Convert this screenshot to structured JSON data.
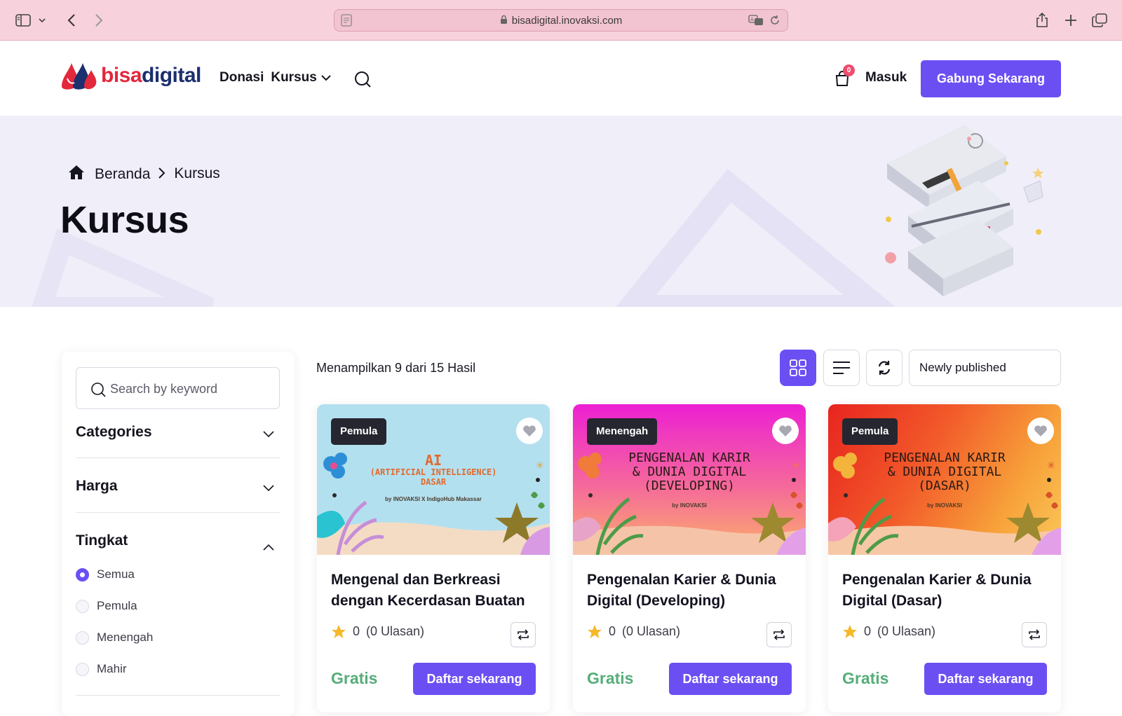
{
  "browser": {
    "url": "bisadigital.inovaksi.com"
  },
  "header": {
    "logo_bisa": "bisa",
    "logo_digital": "digital",
    "nav": [
      "Donasi",
      "Kursus"
    ],
    "cart_count": "0",
    "login_label": "Masuk",
    "join_label": "Gabung Sekarang"
  },
  "hero": {
    "breadcrumb_home": "Beranda",
    "breadcrumb_current": "Kursus",
    "title": "Kursus"
  },
  "sidebar": {
    "search_placeholder": "Search by keyword",
    "filters": [
      "Categories",
      "Harga",
      "Tingkat"
    ],
    "levels": [
      "Semua",
      "Pemula",
      "Menengah",
      "Mahir"
    ],
    "selected_level": "Semua"
  },
  "toolbar": {
    "results_text": "Menampilkan 9 dari 15 Hasil",
    "sort_value": "Newly published",
    "active_view": "grid"
  },
  "colors": {
    "accent": "#6c4ff3",
    "price_green": "#56ad7a",
    "brand_red": "#e3283c",
    "brand_navy": "#1c2f6e"
  },
  "courses": [
    {
      "level": "Pemula",
      "thumb_title_1": "AI",
      "thumb_title_2": "(ARTIFICIAL INTELLIGENCE)",
      "thumb_title_3": "DASAR",
      "thumb_sub": "by INOVAKSI X IndigoHub Makassar",
      "title": "Mengenal dan Berkreasi dengan Kecerdasan Buatan",
      "rating": "0",
      "reviews": "(0 Ulasan)",
      "price": "Gratis",
      "cta": "Daftar sekarang"
    },
    {
      "level": "Menengah",
      "thumb_title_1": "PENGENALAN KARIR",
      "thumb_title_2": "& DUNIA DIGITAL",
      "thumb_title_3": "(DEVELOPING)",
      "thumb_sub": "by INOVAKSI",
      "title": "Pengenalan Karier & Dunia Digital (Developing)",
      "rating": "0",
      "reviews": "(0 Ulasan)",
      "price": "Gratis",
      "cta": "Daftar sekarang"
    },
    {
      "level": "Pemula",
      "thumb_title_1": "PENGENALAN KARIR",
      "thumb_title_2": "& DUNIA DIGITAL",
      "thumb_title_3": "(DASAR)",
      "thumb_sub": "by INOVAKSI",
      "title": "Pengenalan Karier & Dunia Digital (Dasar)",
      "rating": "0",
      "reviews": "(0 Ulasan)",
      "price": "Gratis",
      "cta": "Daftar sekarang"
    }
  ]
}
